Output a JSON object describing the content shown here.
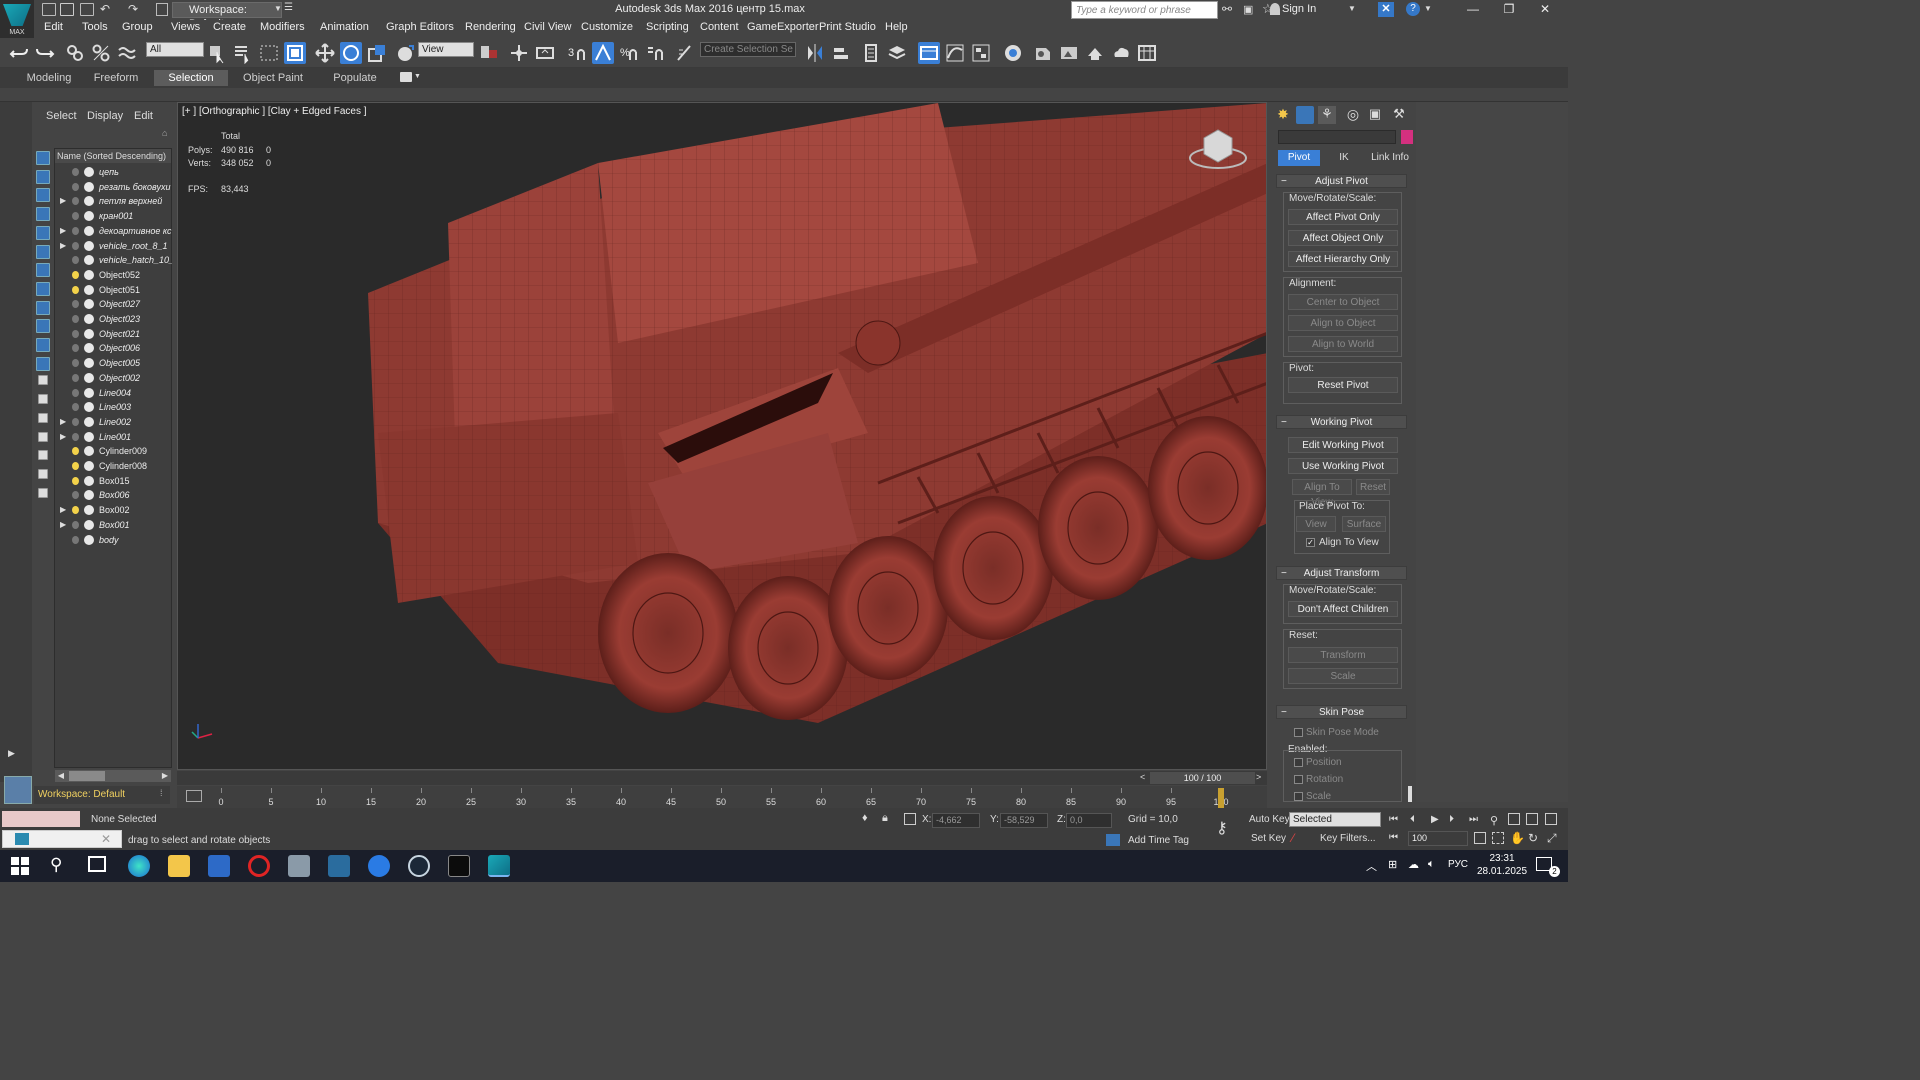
{
  "window": {
    "title": "Autodesk 3ds Max 2016    центр 15.max",
    "logo_text": "MAX",
    "workspace": "Workspace: Default",
    "search_placeholder": "Type a keyword or phrase",
    "sign_in": "Sign In"
  },
  "menu": [
    "Edit",
    "Tools",
    "Group",
    "Views",
    "Create",
    "Modifiers",
    "Animation",
    "Graph Editors",
    "Rendering",
    "Civil View",
    "Customize",
    "Scripting",
    "Content",
    "GameExporter",
    "Print Studio",
    "Help"
  ],
  "toolbar": {
    "selection_filter": "All",
    "ref_coord": "View",
    "named_selection_placeholder": "Create Selection Se"
  },
  "ribbon_tabs": [
    "Modeling",
    "Freeform",
    "Selection",
    "Object Paint",
    "Populate"
  ],
  "ribbon_active": "Selection",
  "scene_explorer": {
    "tabs": [
      "Select",
      "Display",
      "Edit"
    ],
    "column_header": "Name (Sorted Descending)",
    "nodes": [
      {
        "name": "цепь",
        "italic": true,
        "expand": false,
        "light": false
      },
      {
        "name": "резать боковухи",
        "italic": true,
        "expand": false,
        "light": false
      },
      {
        "name": "петля верхней",
        "italic": true,
        "expand": true,
        "light": false
      },
      {
        "name": "кран001",
        "italic": true,
        "expand": false,
        "light": false
      },
      {
        "name": "декоартивное кс",
        "italic": true,
        "expand": true,
        "light": false
      },
      {
        "name": "vehicle_root_8_1",
        "italic": true,
        "expand": true,
        "light": false
      },
      {
        "name": "vehicle_hatch_10_",
        "italic": true,
        "expand": false,
        "light": false
      },
      {
        "name": "Object052",
        "italic": false,
        "expand": false,
        "light": true
      },
      {
        "name": "Object051",
        "italic": false,
        "expand": false,
        "light": true
      },
      {
        "name": "Object027",
        "italic": true,
        "expand": false,
        "light": false
      },
      {
        "name": "Object023",
        "italic": true,
        "expand": false,
        "light": false
      },
      {
        "name": "Object021",
        "italic": true,
        "expand": false,
        "light": false
      },
      {
        "name": "Object006",
        "italic": true,
        "expand": false,
        "light": false
      },
      {
        "name": "Object005",
        "italic": true,
        "expand": false,
        "light": false
      },
      {
        "name": "Object002",
        "italic": true,
        "expand": false,
        "light": false
      },
      {
        "name": "Line004",
        "italic": true,
        "expand": false,
        "light": false
      },
      {
        "name": "Line003",
        "italic": true,
        "expand": false,
        "light": false
      },
      {
        "name": "Line002",
        "italic": true,
        "expand": true,
        "light": false
      },
      {
        "name": "Line001",
        "italic": true,
        "expand": true,
        "light": false
      },
      {
        "name": "Cylinder009",
        "italic": false,
        "expand": false,
        "light": true
      },
      {
        "name": "Cylinder008",
        "italic": false,
        "expand": false,
        "light": true
      },
      {
        "name": "Box015",
        "italic": false,
        "expand": false,
        "light": true
      },
      {
        "name": "Box006",
        "italic": true,
        "expand": false,
        "light": false
      },
      {
        "name": "Box002",
        "italic": false,
        "expand": true,
        "light": true
      },
      {
        "name": "Box001",
        "italic": true,
        "expand": true,
        "light": false
      },
      {
        "name": "body",
        "italic": true,
        "expand": false,
        "light": false
      }
    ],
    "workspace_status": "Workspace: Default"
  },
  "viewport": {
    "label": "[+ ] [Orthographic ] [Clay + Edged Faces ]",
    "stats": {
      "total_label": "Total",
      "polys_label": "Polys:",
      "polys_total": "490 816",
      "polys_sel": "0",
      "verts_label": "Verts:",
      "verts_total": "348 052",
      "verts_sel": "0",
      "fps_label": "FPS:",
      "fps": "83,443"
    },
    "model_color": "#8e3a32"
  },
  "command_panel": {
    "subtabs": [
      "Pivot",
      "IK",
      "Link Info"
    ],
    "active_subtab": "Pivot",
    "adjust_pivot": {
      "title": "Adjust Pivot",
      "move_label": "Move/Rotate/Scale:",
      "affect_pivot": "Affect Pivot Only",
      "affect_object": "Affect Object Only",
      "affect_hierarchy": "Affect Hierarchy Only",
      "alignment_label": "Alignment:",
      "center_to_object": "Center to Object",
      "align_to_object": "Align to Object",
      "align_to_world": "Align to World",
      "pivot_label": "Pivot:",
      "reset_pivot": "Reset Pivot"
    },
    "working_pivot": {
      "title": "Working Pivot",
      "edit": "Edit Working Pivot",
      "use": "Use Working Pivot",
      "align_to_view": "Align To View",
      "reset": "Reset",
      "place_label": "Place Pivot To:",
      "view": "View",
      "surface": "Surface",
      "align_to_view_check": "Align To View"
    },
    "adjust_transform": {
      "title": "Adjust Transform",
      "move_label": "Move/Rotate/Scale:",
      "dont_affect": "Don't Affect Children",
      "reset_label": "Reset:",
      "transform": "Transform",
      "scale": "Scale"
    },
    "skin_pose": {
      "title": "Skin Pose",
      "mode": "Skin Pose Mode",
      "enabled_label": "Enabled:",
      "position": "Position",
      "rotation": "Rotation",
      "scale": "Scale"
    }
  },
  "timeline": {
    "slider_label": "100 / 100",
    "ticks": [
      "0",
      "5",
      "10",
      "15",
      "20",
      "25",
      "30",
      "35",
      "40",
      "45",
      "50",
      "55",
      "60",
      "65",
      "70",
      "75",
      "80",
      "85",
      "90",
      "95",
      "100"
    ],
    "current_frame_fraction": 1.0
  },
  "status": {
    "selection": "None Selected",
    "prompt": "drag to select and rotate objects",
    "x_label": "X:",
    "x_value": "-4,662",
    "y_label": "Y:",
    "y_value": "-58,529",
    "z_label": "Z:",
    "z_value": "0,0",
    "grid": "Grid = 10,0",
    "add_time_tag": "Add Time Tag",
    "auto_key": "Auto Key",
    "selected": "Selected",
    "set_key": "Set Key",
    "key_filters": "Key Filters...",
    "frame": "100"
  },
  "taskbar": {
    "language": "РУС",
    "time": "23:31",
    "date": "28.01.2025",
    "notifications": "2"
  }
}
